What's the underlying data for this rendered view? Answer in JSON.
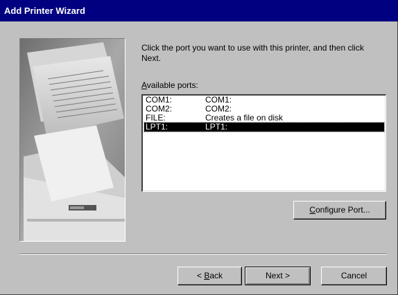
{
  "window": {
    "title": "Add Printer Wizard"
  },
  "instruction": "Click the port you want to use with this printer, and then click Next.",
  "ports_label": {
    "mnemonic": "A",
    "rest": "vailable ports:"
  },
  "ports": [
    {
      "port": "COM1:",
      "description": "COM1:",
      "selected": false
    },
    {
      "port": "COM2:",
      "description": "COM2:",
      "selected": false
    },
    {
      "port": "FILE:",
      "description": "Creates a file on disk",
      "selected": false
    },
    {
      "port": "LPT1:",
      "description": "LPT1:",
      "selected": true
    }
  ],
  "buttons": {
    "configure": {
      "mnemonic": "C",
      "rest": "onfigure Port..."
    },
    "back": {
      "prefix": "< ",
      "mnemonic": "B",
      "rest": "ack"
    },
    "next": {
      "label": "Next >"
    },
    "cancel": {
      "label": "Cancel"
    }
  }
}
